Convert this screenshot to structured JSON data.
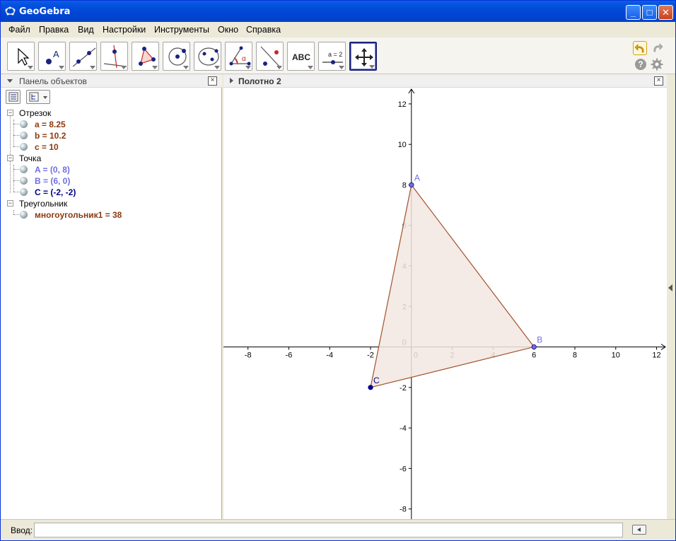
{
  "window": {
    "title": "GeoGebra",
    "minimize": "_",
    "maximize": "□",
    "close": "✕"
  },
  "menu": [
    "Файл",
    "Правка",
    "Вид",
    "Настройки",
    "Инструменты",
    "Окно",
    "Справка"
  ],
  "toolbar": {
    "tools": [
      "move-tool",
      "point-tool",
      "line-tool",
      "perpendicular-tool",
      "polygon-tool",
      "circle-tool",
      "conic-tool",
      "angle-tool",
      "reflect-tool",
      "text-tool",
      "slider-tool",
      "move-view-tool"
    ],
    "text_tool_label": "ABC",
    "slider_tool_label": "a = 2",
    "help": "?"
  },
  "algebra": {
    "title": "Панель объектов",
    "groups": [
      {
        "name": "Отрезок",
        "items": [
          {
            "text": "a = 8.25",
            "color": "#8b3a0f"
          },
          {
            "text": "b = 10.2",
            "color": "#8b3a0f"
          },
          {
            "text": "c = 10",
            "color": "#8b3a0f"
          }
        ]
      },
      {
        "name": "Точка",
        "items": [
          {
            "text": "A = (0, 8)",
            "color": "#6f6fe0"
          },
          {
            "text": "B = (6, 0)",
            "color": "#6f6fe0"
          },
          {
            "text": "C = (-2, -2)",
            "color": "#00008b"
          }
        ]
      },
      {
        "name": "Треугольник",
        "items": [
          {
            "text": "многоугольник1 = 38",
            "color": "#8b3a0f"
          }
        ]
      }
    ]
  },
  "graphics": {
    "title": "Полотно 2",
    "x_range": [
      -9.2,
      12.5
    ],
    "y_range": [
      -8.5,
      12.8
    ],
    "x_ticks": [
      -8,
      -6,
      -4,
      -2,
      0,
      2,
      4,
      6,
      8,
      10,
      12
    ],
    "y_ticks": [
      -8,
      -6,
      -4,
      -2,
      0,
      2,
      4,
      6,
      8,
      10,
      12
    ],
    "points": [
      {
        "name": "A",
        "x": 0,
        "y": 8,
        "color": "#6f6fe0"
      },
      {
        "name": "B",
        "x": 6,
        "y": 0,
        "color": "#6f6fe0"
      },
      {
        "name": "C",
        "x": -2,
        "y": -2,
        "color": "#00008b"
      }
    ],
    "polygon_fill": "#f2e6e2",
    "polygon_stroke": "#a0522d"
  },
  "inputbar": {
    "label": "Ввод:",
    "value": ""
  }
}
